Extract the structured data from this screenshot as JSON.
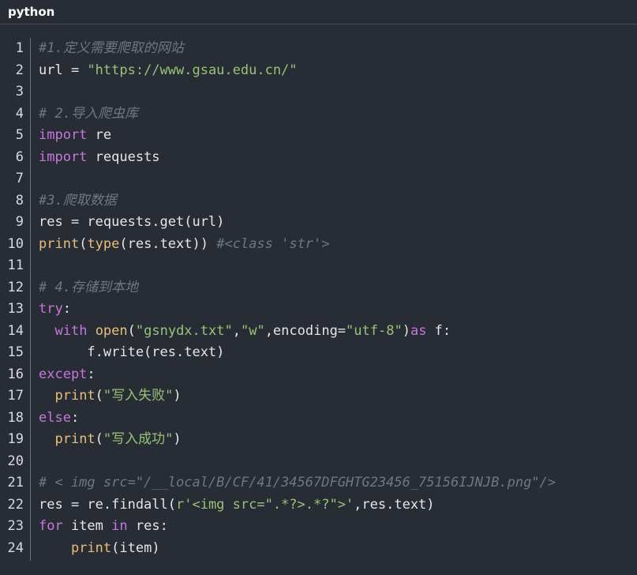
{
  "header": {
    "language": "python"
  },
  "lines": [
    [
      {
        "t": "com",
        "v": "#1.定义需要爬取的网站"
      }
    ],
    [
      {
        "t": "pl",
        "v": "url = "
      },
      {
        "t": "str",
        "v": "\"https://www.gsau.edu.cn/\""
      }
    ],
    [],
    [
      {
        "t": "com",
        "v": "# 2.导入爬虫库"
      }
    ],
    [
      {
        "t": "kw",
        "v": "import"
      },
      {
        "t": "pl",
        "v": " re"
      }
    ],
    [
      {
        "t": "kw",
        "v": "import"
      },
      {
        "t": "pl",
        "v": " requests"
      }
    ],
    [],
    [
      {
        "t": "com",
        "v": "#3.爬取数据"
      }
    ],
    [
      {
        "t": "pl",
        "v": "res = requests.get(url)"
      }
    ],
    [
      {
        "t": "fn",
        "v": "print"
      },
      {
        "t": "pl",
        "v": "("
      },
      {
        "t": "fn",
        "v": "type"
      },
      {
        "t": "pl",
        "v": "(res.text)) "
      },
      {
        "t": "com",
        "v": "#<class 'str'>"
      }
    ],
    [],
    [
      {
        "t": "com",
        "v": "# 4.存储到本地"
      }
    ],
    [
      {
        "t": "kw",
        "v": "try"
      },
      {
        "t": "pl",
        "v": ":"
      }
    ],
    [
      {
        "t": "pl",
        "v": "  "
      },
      {
        "t": "kw",
        "v": "with"
      },
      {
        "t": "pl",
        "v": " "
      },
      {
        "t": "fn",
        "v": "open"
      },
      {
        "t": "pl",
        "v": "("
      },
      {
        "t": "str",
        "v": "\"gsnydx.txt\""
      },
      {
        "t": "pl",
        "v": ","
      },
      {
        "t": "str",
        "v": "\"w\""
      },
      {
        "t": "pl",
        "v": ",encoding="
      },
      {
        "t": "str",
        "v": "\"utf-8\""
      },
      {
        "t": "pl",
        "v": ")"
      },
      {
        "t": "kw",
        "v": "as"
      },
      {
        "t": "pl",
        "v": " f:"
      }
    ],
    [
      {
        "t": "pl",
        "v": "      f.write(res.text)"
      }
    ],
    [
      {
        "t": "kw",
        "v": "except"
      },
      {
        "t": "pl",
        "v": ":"
      }
    ],
    [
      {
        "t": "pl",
        "v": "  "
      },
      {
        "t": "fn",
        "v": "print"
      },
      {
        "t": "pl",
        "v": "("
      },
      {
        "t": "str",
        "v": "\"写入失败\""
      },
      {
        "t": "pl",
        "v": ")"
      }
    ],
    [
      {
        "t": "kw",
        "v": "else"
      },
      {
        "t": "pl",
        "v": ":"
      }
    ],
    [
      {
        "t": "pl",
        "v": "  "
      },
      {
        "t": "fn",
        "v": "print"
      },
      {
        "t": "pl",
        "v": "("
      },
      {
        "t": "str",
        "v": "\"写入成功\""
      },
      {
        "t": "pl",
        "v": ")"
      }
    ],
    [],
    [
      {
        "t": "com",
        "v": "# < img src=\"/__local/B/CF/41/34567DFGHTG23456_75156IJNJB.png\"/>"
      }
    ],
    [
      {
        "t": "pl",
        "v": "res = re.findall("
      },
      {
        "t": "str",
        "v": "r'<img src=\".*?>.*?\">'"
      },
      {
        "t": "pl",
        "v": ",res.text)"
      }
    ],
    [
      {
        "t": "kw",
        "v": "for"
      },
      {
        "t": "pl",
        "v": " item "
      },
      {
        "t": "kw",
        "v": "in"
      },
      {
        "t": "pl",
        "v": " res:"
      }
    ],
    [
      {
        "t": "pl",
        "v": "    "
      },
      {
        "t": "fn",
        "v": "print"
      },
      {
        "t": "pl",
        "v": "(item)"
      }
    ]
  ],
  "line_numbers": [
    "1",
    "2",
    "3",
    "4",
    "5",
    "6",
    "7",
    "8",
    "9",
    "10",
    "11",
    "12",
    "13",
    "14",
    "15",
    "16",
    "17",
    "18",
    "19",
    "20",
    "21",
    "22",
    "23",
    "24"
  ],
  "colors": {
    "background": "#282c34",
    "keyword": "#c678dd",
    "function": "#e5c07b",
    "string": "#98c379",
    "comment": "#6f7782",
    "plain": "#e6e6e6"
  }
}
